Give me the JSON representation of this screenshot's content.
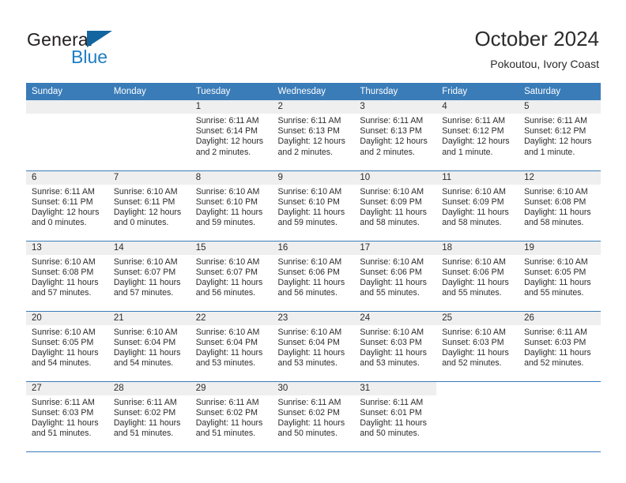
{
  "brand": {
    "name_line1": "General",
    "name_line2": "Blue",
    "flag_icon": "triangle-flag-icon"
  },
  "header": {
    "title": "October 2024",
    "subtitle": "Pokoutou, Ivory Coast"
  },
  "theme": {
    "header_blue": "#3a7cb8",
    "brand_blue": "#1f7ec4",
    "flag_blue": "#12659f",
    "daynum_gray": "#efefef",
    "text": "#2b2b2b"
  },
  "weekdays": [
    "Sunday",
    "Monday",
    "Tuesday",
    "Wednesday",
    "Thursday",
    "Friday",
    "Saturday"
  ],
  "labels": {
    "sunrise": "Sunrise:",
    "sunset": "Sunset:",
    "daylight": "Daylight:"
  },
  "weeks": [
    [
      {
        "day": "",
        "sunrise": "",
        "sunset": "",
        "daylight_line1": "",
        "daylight_line2": ""
      },
      {
        "day": "",
        "sunrise": "",
        "sunset": "",
        "daylight_line1": "",
        "daylight_line2": ""
      },
      {
        "day": "1",
        "sunrise": "Sunrise: 6:11 AM",
        "sunset": "Sunset: 6:14 PM",
        "daylight_line1": "Daylight: 12 hours",
        "daylight_line2": "and 2 minutes."
      },
      {
        "day": "2",
        "sunrise": "Sunrise: 6:11 AM",
        "sunset": "Sunset: 6:13 PM",
        "daylight_line1": "Daylight: 12 hours",
        "daylight_line2": "and 2 minutes."
      },
      {
        "day": "3",
        "sunrise": "Sunrise: 6:11 AM",
        "sunset": "Sunset: 6:13 PM",
        "daylight_line1": "Daylight: 12 hours",
        "daylight_line2": "and 2 minutes."
      },
      {
        "day": "4",
        "sunrise": "Sunrise: 6:11 AM",
        "sunset": "Sunset: 6:12 PM",
        "daylight_line1": "Daylight: 12 hours",
        "daylight_line2": "and 1 minute."
      },
      {
        "day": "5",
        "sunrise": "Sunrise: 6:11 AM",
        "sunset": "Sunset: 6:12 PM",
        "daylight_line1": "Daylight: 12 hours",
        "daylight_line2": "and 1 minute."
      }
    ],
    [
      {
        "day": "6",
        "sunrise": "Sunrise: 6:11 AM",
        "sunset": "Sunset: 6:11 PM",
        "daylight_line1": "Daylight: 12 hours",
        "daylight_line2": "and 0 minutes."
      },
      {
        "day": "7",
        "sunrise": "Sunrise: 6:10 AM",
        "sunset": "Sunset: 6:11 PM",
        "daylight_line1": "Daylight: 12 hours",
        "daylight_line2": "and 0 minutes."
      },
      {
        "day": "8",
        "sunrise": "Sunrise: 6:10 AM",
        "sunset": "Sunset: 6:10 PM",
        "daylight_line1": "Daylight: 11 hours",
        "daylight_line2": "and 59 minutes."
      },
      {
        "day": "9",
        "sunrise": "Sunrise: 6:10 AM",
        "sunset": "Sunset: 6:10 PM",
        "daylight_line1": "Daylight: 11 hours",
        "daylight_line2": "and 59 minutes."
      },
      {
        "day": "10",
        "sunrise": "Sunrise: 6:10 AM",
        "sunset": "Sunset: 6:09 PM",
        "daylight_line1": "Daylight: 11 hours",
        "daylight_line2": "and 58 minutes."
      },
      {
        "day": "11",
        "sunrise": "Sunrise: 6:10 AM",
        "sunset": "Sunset: 6:09 PM",
        "daylight_line1": "Daylight: 11 hours",
        "daylight_line2": "and 58 minutes."
      },
      {
        "day": "12",
        "sunrise": "Sunrise: 6:10 AM",
        "sunset": "Sunset: 6:08 PM",
        "daylight_line1": "Daylight: 11 hours",
        "daylight_line2": "and 58 minutes."
      }
    ],
    [
      {
        "day": "13",
        "sunrise": "Sunrise: 6:10 AM",
        "sunset": "Sunset: 6:08 PM",
        "daylight_line1": "Daylight: 11 hours",
        "daylight_line2": "and 57 minutes."
      },
      {
        "day": "14",
        "sunrise": "Sunrise: 6:10 AM",
        "sunset": "Sunset: 6:07 PM",
        "daylight_line1": "Daylight: 11 hours",
        "daylight_line2": "and 57 minutes."
      },
      {
        "day": "15",
        "sunrise": "Sunrise: 6:10 AM",
        "sunset": "Sunset: 6:07 PM",
        "daylight_line1": "Daylight: 11 hours",
        "daylight_line2": "and 56 minutes."
      },
      {
        "day": "16",
        "sunrise": "Sunrise: 6:10 AM",
        "sunset": "Sunset: 6:06 PM",
        "daylight_line1": "Daylight: 11 hours",
        "daylight_line2": "and 56 minutes."
      },
      {
        "day": "17",
        "sunrise": "Sunrise: 6:10 AM",
        "sunset": "Sunset: 6:06 PM",
        "daylight_line1": "Daylight: 11 hours",
        "daylight_line2": "and 55 minutes."
      },
      {
        "day": "18",
        "sunrise": "Sunrise: 6:10 AM",
        "sunset": "Sunset: 6:06 PM",
        "daylight_line1": "Daylight: 11 hours",
        "daylight_line2": "and 55 minutes."
      },
      {
        "day": "19",
        "sunrise": "Sunrise: 6:10 AM",
        "sunset": "Sunset: 6:05 PM",
        "daylight_line1": "Daylight: 11 hours",
        "daylight_line2": "and 55 minutes."
      }
    ],
    [
      {
        "day": "20",
        "sunrise": "Sunrise: 6:10 AM",
        "sunset": "Sunset: 6:05 PM",
        "daylight_line1": "Daylight: 11 hours",
        "daylight_line2": "and 54 minutes."
      },
      {
        "day": "21",
        "sunrise": "Sunrise: 6:10 AM",
        "sunset": "Sunset: 6:04 PM",
        "daylight_line1": "Daylight: 11 hours",
        "daylight_line2": "and 54 minutes."
      },
      {
        "day": "22",
        "sunrise": "Sunrise: 6:10 AM",
        "sunset": "Sunset: 6:04 PM",
        "daylight_line1": "Daylight: 11 hours",
        "daylight_line2": "and 53 minutes."
      },
      {
        "day": "23",
        "sunrise": "Sunrise: 6:10 AM",
        "sunset": "Sunset: 6:04 PM",
        "daylight_line1": "Daylight: 11 hours",
        "daylight_line2": "and 53 minutes."
      },
      {
        "day": "24",
        "sunrise": "Sunrise: 6:10 AM",
        "sunset": "Sunset: 6:03 PM",
        "daylight_line1": "Daylight: 11 hours",
        "daylight_line2": "and 53 minutes."
      },
      {
        "day": "25",
        "sunrise": "Sunrise: 6:10 AM",
        "sunset": "Sunset: 6:03 PM",
        "daylight_line1": "Daylight: 11 hours",
        "daylight_line2": "and 52 minutes."
      },
      {
        "day": "26",
        "sunrise": "Sunrise: 6:11 AM",
        "sunset": "Sunset: 6:03 PM",
        "daylight_line1": "Daylight: 11 hours",
        "daylight_line2": "and 52 minutes."
      }
    ],
    [
      {
        "day": "27",
        "sunrise": "Sunrise: 6:11 AM",
        "sunset": "Sunset: 6:03 PM",
        "daylight_line1": "Daylight: 11 hours",
        "daylight_line2": "and 51 minutes."
      },
      {
        "day": "28",
        "sunrise": "Sunrise: 6:11 AM",
        "sunset": "Sunset: 6:02 PM",
        "daylight_line1": "Daylight: 11 hours",
        "daylight_line2": "and 51 minutes."
      },
      {
        "day": "29",
        "sunrise": "Sunrise: 6:11 AM",
        "sunset": "Sunset: 6:02 PM",
        "daylight_line1": "Daylight: 11 hours",
        "daylight_line2": "and 51 minutes."
      },
      {
        "day": "30",
        "sunrise": "Sunrise: 6:11 AM",
        "sunset": "Sunset: 6:02 PM",
        "daylight_line1": "Daylight: 11 hours",
        "daylight_line2": "and 50 minutes."
      },
      {
        "day": "31",
        "sunrise": "Sunrise: 6:11 AM",
        "sunset": "Sunset: 6:01 PM",
        "daylight_line1": "Daylight: 11 hours",
        "daylight_line2": "and 50 minutes."
      },
      {
        "day": "",
        "sunrise": "",
        "sunset": "",
        "daylight_line1": "",
        "daylight_line2": ""
      },
      {
        "day": "",
        "sunrise": "",
        "sunset": "",
        "daylight_line1": "",
        "daylight_line2": ""
      }
    ]
  ]
}
